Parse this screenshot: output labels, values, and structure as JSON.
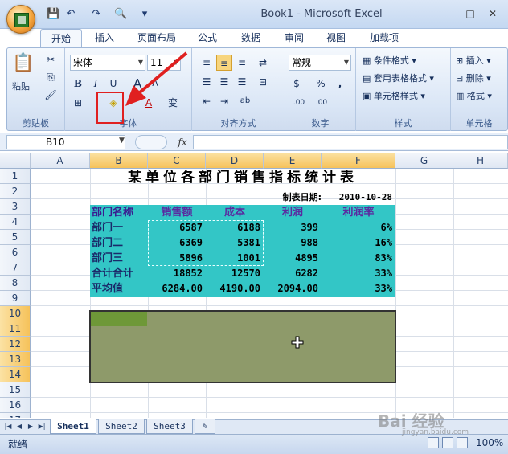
{
  "window": {
    "title": "Book1 - Microsoft Excel",
    "minimize": "–",
    "maximize": "□",
    "close": "✕"
  },
  "quick_access": {
    "save": "💾",
    "undo": "↶",
    "redo": "↷",
    "print_preview": "🔍",
    "customize": "▾"
  },
  "tabs": [
    "开始",
    "插入",
    "页面布局",
    "公式",
    "数据",
    "审阅",
    "视图",
    "加载项"
  ],
  "ribbon": {
    "clipboard": {
      "label": "剪贴板",
      "paste": "粘贴",
      "cut": "✂",
      "copy": "⎘",
      "format_painter": "🖌"
    },
    "font": {
      "label": "字体",
      "font_name": "宋体",
      "font_size": "11",
      "bold": "B",
      "italic": "I",
      "underline": "U",
      "grow": "A",
      "shrink": "A",
      "border": "⊞",
      "fill": "◈",
      "font_color": "A",
      "phonetic": "变"
    },
    "alignment": {
      "label": "对齐方式",
      "wrap": "⇄",
      "merge": "⊟",
      "indent_dec": "⇤",
      "indent_inc": "⇥",
      "orient": "ab"
    },
    "number": {
      "label": "数字",
      "format": "常规",
      "currency": "$",
      "percent": "%",
      "comma": ",",
      "inc_dec": ".00",
      "dec_dec": ".00"
    },
    "styles": {
      "label": "样式",
      "conditional": "条件格式",
      "table": "套用表格格式",
      "cell": "单元格样式"
    },
    "cells": {
      "label": "单元格",
      "insert": "插入",
      "delete": "删除",
      "format": "格式"
    }
  },
  "formula_bar": {
    "name_box": "B10",
    "fx": "fx",
    "value": ""
  },
  "columns": [
    "A",
    "B",
    "C",
    "D",
    "E",
    "F",
    "G",
    "H"
  ],
  "rows": [
    "1",
    "2",
    "3",
    "4",
    "5",
    "6",
    "7",
    "8",
    "9",
    "10",
    "11",
    "12",
    "13",
    "14",
    "15",
    "16",
    "17"
  ],
  "sheet": {
    "title": "某单位各部门销售指标统计表",
    "date_label": "制表日期:",
    "date_value": "2010-10-28",
    "headers": [
      "部门名称",
      "销售额",
      "成本",
      "利润",
      "利润率"
    ],
    "table": [
      [
        "部门一",
        "6587",
        "6188",
        "399",
        "6%"
      ],
      [
        "部门二",
        "6369",
        "5381",
        "988",
        "16%"
      ],
      [
        "部门三",
        "5896",
        "1001",
        "4895",
        "83%"
      ],
      [
        "合计合计",
        "18852",
        "12570",
        "6282",
        "33%"
      ],
      [
        "平均值",
        "6284.00",
        "4190.00",
        "2094.00",
        "33%"
      ]
    ]
  },
  "sheet_tabs": [
    "Sheet1",
    "Sheet2",
    "Sheet3"
  ],
  "status": {
    "ready": "就绪",
    "zoom": "100%"
  },
  "watermark": {
    "main": "Bai 经验",
    "sub": "jingyan.baidu.com"
  },
  "colors": {
    "teal": "#33c6c6",
    "olive": "#8e9a6a",
    "accent_red": "#e02020"
  }
}
